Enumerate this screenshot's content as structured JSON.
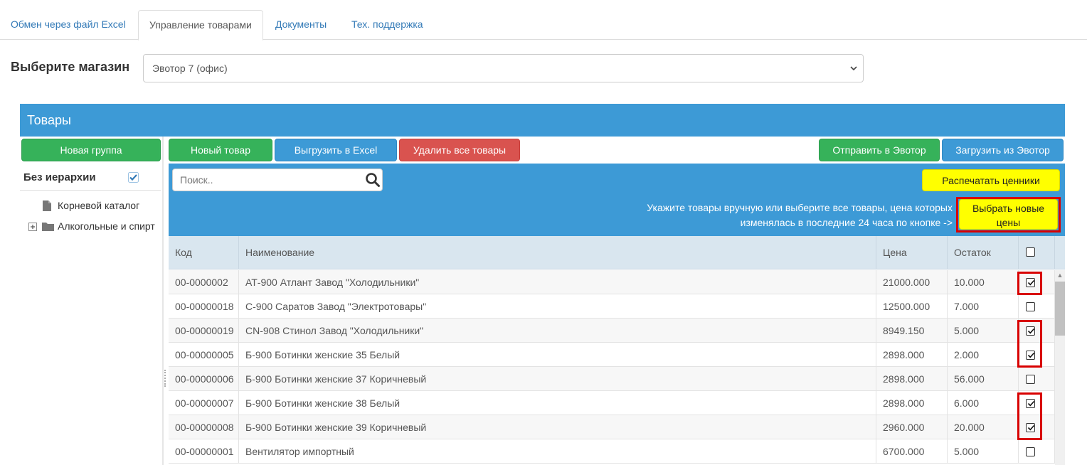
{
  "tabs": [
    {
      "label": "Обмен через файл Excel"
    },
    {
      "label": "Управление товарами"
    },
    {
      "label": "Документы"
    },
    {
      "label": "Тех. поддержка"
    }
  ],
  "store": {
    "label": "Выберите магазин",
    "selected": "Эвотор 7 (офис)"
  },
  "panel": {
    "title": "Товары"
  },
  "sidebar": {
    "new_group_label": "Новая группа",
    "no_hierarchy_label": "Без иерархии",
    "no_hierarchy_checked": true,
    "items": [
      {
        "label": "Корневой каталог",
        "icon": "file-icon"
      },
      {
        "label": "Алкогольные и спирт",
        "icon": "folder-icon",
        "expander": "⊞"
      }
    ]
  },
  "toolbar": {
    "new_item": "Новый товар",
    "export_excel": "Выгрузить в Excel",
    "delete_all": "Удалить все товары",
    "send_evotor": "Отправить в Эвотор",
    "load_evotor": "Загрузить из Эвотор"
  },
  "search": {
    "placeholder": "Поиск.."
  },
  "print_button": "Распечатать ценники",
  "hint": {
    "line1": "Укажите товары вручную или выберите все товары, цена которых",
    "line2": "изменялась в последние 24 часа по кнопке ->"
  },
  "select_new_prices_button": {
    "line1": "Выбрать новые",
    "line2": "цены"
  },
  "table": {
    "columns": [
      "Код",
      "Наименование",
      "Цена",
      "Остаток"
    ],
    "rows": [
      {
        "code": "00-0000002",
        "name": "АТ-900 Атлант Завод \"Холодильники\"",
        "price": "21000.000",
        "stock": "10.000",
        "checked": true
      },
      {
        "code": "00-00000018",
        "name": "С-900 Саратов Завод \"Электротовары\"",
        "price": "12500.000",
        "stock": "7.000",
        "checked": false
      },
      {
        "code": "00-00000019",
        "name": "CN-908 Стинол Завод \"Холодильники\"",
        "price": "8949.150",
        "stock": "5.000",
        "checked": true
      },
      {
        "code": "00-00000005",
        "name": "Б-900 Ботинки женские 35 Белый",
        "price": "2898.000",
        "stock": "2.000",
        "checked": true
      },
      {
        "code": "00-00000006",
        "name": "Б-900 Ботинки женские 37 Коричневый",
        "price": "2898.000",
        "stock": "56.000",
        "checked": false
      },
      {
        "code": "00-00000007",
        "name": "Б-900 Ботинки женские 38 Белый",
        "price": "2898.000",
        "stock": "6.000",
        "checked": true
      },
      {
        "code": "00-00000008",
        "name": "Б-900 Ботинки женские 39 Коричневый",
        "price": "2960.000",
        "stock": "20.000",
        "checked": true
      },
      {
        "code": "00-00000001",
        "name": "Вентилятор импортный",
        "price": "6700.000",
        "stock": "5.000",
        "checked": false
      }
    ]
  },
  "colors": {
    "primary": "#3d9ad6",
    "success": "#36b25a",
    "danger": "#d9534f",
    "highlight": "#ffff00",
    "annotation": "#d80000"
  }
}
